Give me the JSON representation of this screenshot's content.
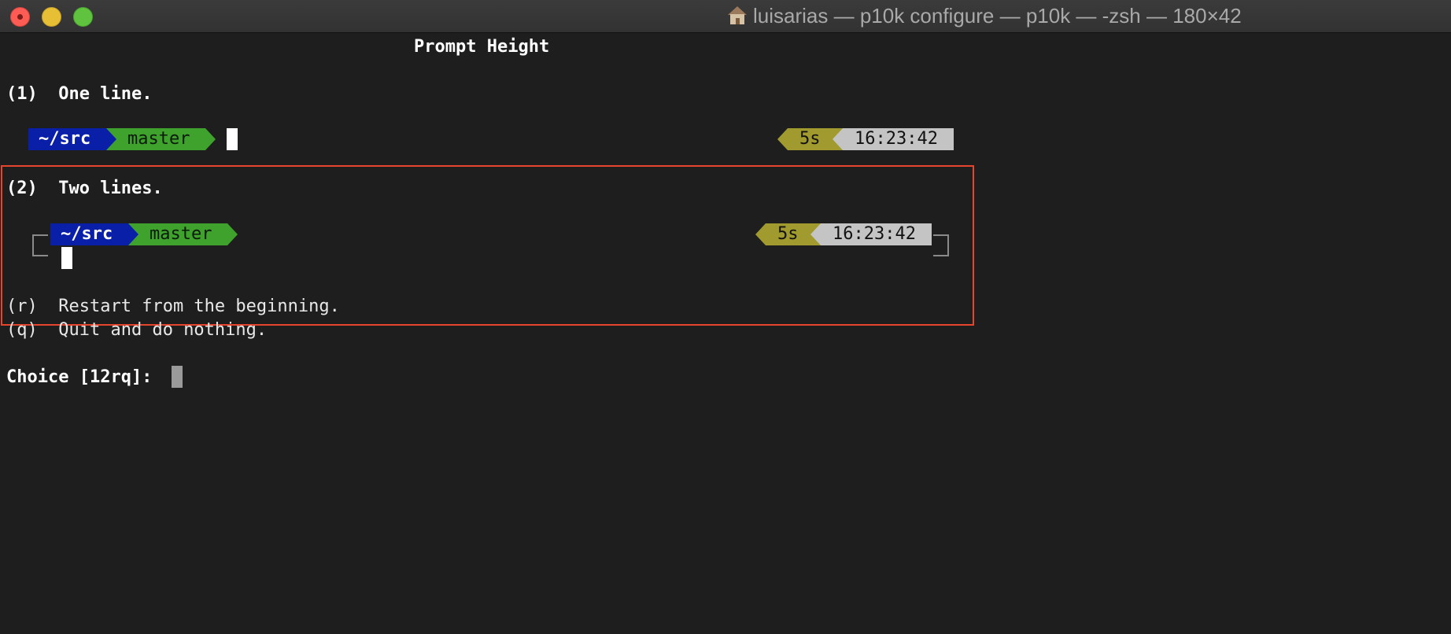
{
  "window": {
    "title": "luisarias — p10k configure — p10k — -zsh — 180×42",
    "title_icon": "home-icon",
    "buttons": {
      "close": "close-button",
      "minimize": "minimize-button",
      "maximize": "maximize-button"
    }
  },
  "terminal": {
    "heading": "Prompt Height",
    "option1": {
      "key": "(1)",
      "label": "One line."
    },
    "option2": {
      "key": "(2)",
      "label": "Two lines."
    },
    "preview": {
      "dir": "~/src",
      "branch": "master",
      "duration": "5s",
      "time": "16:23:42"
    },
    "restart": {
      "key": "(r)",
      "label": "Restart from the beginning."
    },
    "quit": {
      "key": "(q)",
      "label": "Quit and do nothing."
    },
    "choice_prompt": "Choice [12rq]:"
  },
  "colors": {
    "dir_segment": "#0a1fa8",
    "vcs_segment": "#3ea22c",
    "duration_segment": "#a19a2e",
    "time_segment": "#c4c4c4",
    "highlight_border": "#e4452c",
    "background": "#1e1e1e"
  }
}
